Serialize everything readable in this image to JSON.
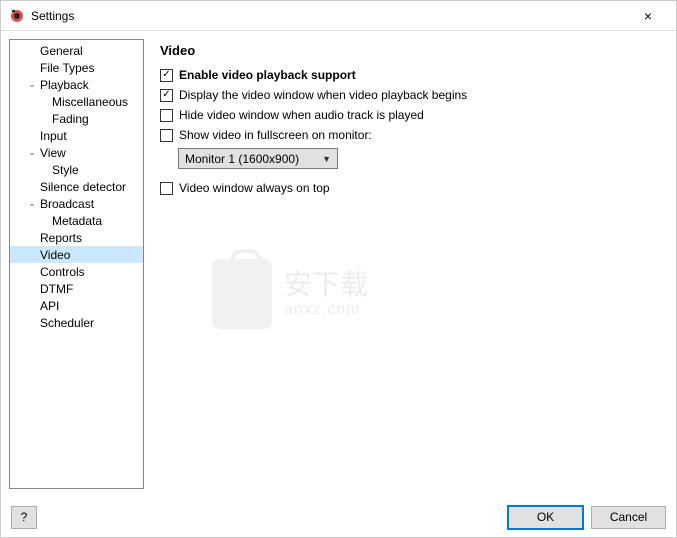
{
  "window": {
    "title": "Settings",
    "close_label": "×"
  },
  "tree": {
    "items": [
      {
        "label": "General",
        "indent": 1,
        "expander": ""
      },
      {
        "label": "File Types",
        "indent": 1,
        "expander": ""
      },
      {
        "label": "Playback",
        "indent": 1,
        "expander": "v"
      },
      {
        "label": "Miscellaneous",
        "indent": 2,
        "expander": ""
      },
      {
        "label": "Fading",
        "indent": 2,
        "expander": ""
      },
      {
        "label": "Input",
        "indent": 1,
        "expander": ""
      },
      {
        "label": "View",
        "indent": 1,
        "expander": "v"
      },
      {
        "label": "Style",
        "indent": 2,
        "expander": ""
      },
      {
        "label": "Silence detector",
        "indent": 1,
        "expander": ""
      },
      {
        "label": "Broadcast",
        "indent": 1,
        "expander": "v"
      },
      {
        "label": "Metadata",
        "indent": 2,
        "expander": ""
      },
      {
        "label": "Reports",
        "indent": 1,
        "expander": ""
      },
      {
        "label": "Video",
        "indent": 1,
        "expander": "",
        "selected": true
      },
      {
        "label": "Controls",
        "indent": 1,
        "expander": ""
      },
      {
        "label": "DTMF",
        "indent": 1,
        "expander": ""
      },
      {
        "label": "API",
        "indent": 1,
        "expander": ""
      },
      {
        "label": "Scheduler",
        "indent": 1,
        "expander": ""
      }
    ]
  },
  "panel": {
    "title": "Video",
    "enable_label": "Enable video playback support",
    "enable_checked": true,
    "display_label": "Display the video window when video playback begins",
    "display_checked": true,
    "hide_label": "Hide video window when audio track is played",
    "hide_checked": false,
    "fullscreen_label": "Show video in fullscreen on monitor:",
    "fullscreen_checked": false,
    "monitor_value": "Monitor 1 (1600x900)",
    "ontop_label": "Video window always on top",
    "ontop_checked": false
  },
  "watermark": {
    "line1": "安下载",
    "line2": "anxz.com"
  },
  "footer": {
    "help_label": "?",
    "ok_label": "OK",
    "cancel_label": "Cancel"
  }
}
